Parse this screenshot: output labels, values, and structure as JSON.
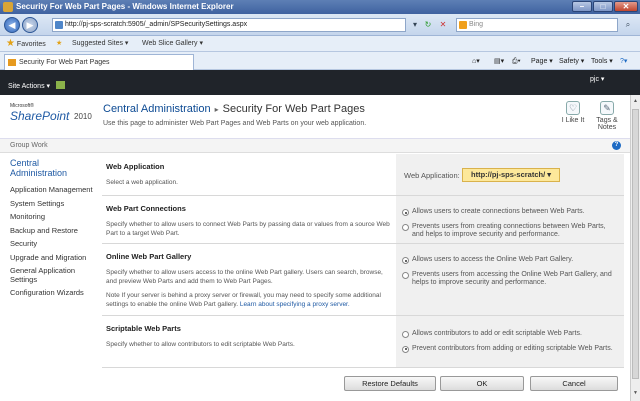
{
  "window": {
    "title": "Security For Web Part Pages - Windows Internet Explorer",
    "min": "–",
    "max": "□",
    "close": "✕"
  },
  "address": {
    "url": "http://pj-sps-scratch:5905/_admin/SPSecuritySettings.aspx",
    "search_placeholder": "Bing"
  },
  "favorites": {
    "label": "Favorites",
    "items": [
      "Suggested Sites ▾",
      "Web Slice Gallery ▾"
    ]
  },
  "tab": {
    "title": "Security For Web Part Pages"
  },
  "commands": [
    "Page ▾",
    "Safety ▾",
    "Tools ▾"
  ],
  "ribbon": {
    "site_actions": "Site Actions ▾",
    "user": "pjc ▾"
  },
  "header": {
    "logo_ms": "Microsoft®",
    "logo_sp": "SharePoint",
    "logo_year": "2010",
    "breadcrumb_root": "Central Administration",
    "breadcrumb_sep": "▸",
    "breadcrumb_page": "Security For Web Part Pages",
    "description": "Use this page to administer Web Part Pages and Web Parts on your web application.",
    "i_like_it": "I Like It",
    "tags_notes": "Tags & Notes"
  },
  "group_work": "Group Work",
  "quicklaunch": {
    "top": "Central Administration",
    "items": [
      "Application Management",
      "System Settings",
      "Monitoring",
      "Backup and Restore",
      "Security",
      "Upgrade and Migration",
      "General Application Settings",
      "Configuration Wizards"
    ]
  },
  "sections": {
    "web_app": {
      "title": "Web Application",
      "desc": "Select a web application.",
      "label": "Web Application:",
      "value": "http://pj-sps-scratch/ ▾"
    },
    "connections": {
      "title": "Web Part Connections",
      "desc": "Specify whether to allow users to connect Web Parts by passing data or values from a source Web Part to a target Web Part.",
      "opt1": "Allows users to create connections between Web Parts.",
      "opt2": "Prevents users from creating connections between Web Parts, and helps to improve security and performance."
    },
    "gallery": {
      "title": "Online Web Part Gallery",
      "desc": "Specify whether to allow users access to the online Web Part gallery.  Users can search, browse, and preview Web Parts and add them to Web Part Pages.",
      "note": "Note If your server is behind a proxy server or firewall, you may need to specify some additional settings to enable the online Web Part gallery.",
      "link": "Learn about specifying a proxy server.",
      "opt1": "Allows users to access the Online Web Part Gallery.",
      "opt2": "Prevents users from accessing the Online Web Part Gallery, and helps to improve security and performance."
    },
    "scriptable": {
      "title": "Scriptable Web Parts",
      "desc": "Specify whether to allow contributors to edit scriptable Web Parts.",
      "opt1": "Allows contributors to add or edit scriptable Web Parts.",
      "opt2": "Prevent contributors from adding or editing scriptable Web Parts."
    }
  },
  "buttons": {
    "restore": "Restore Defaults",
    "ok": "OK",
    "cancel": "Cancel"
  }
}
